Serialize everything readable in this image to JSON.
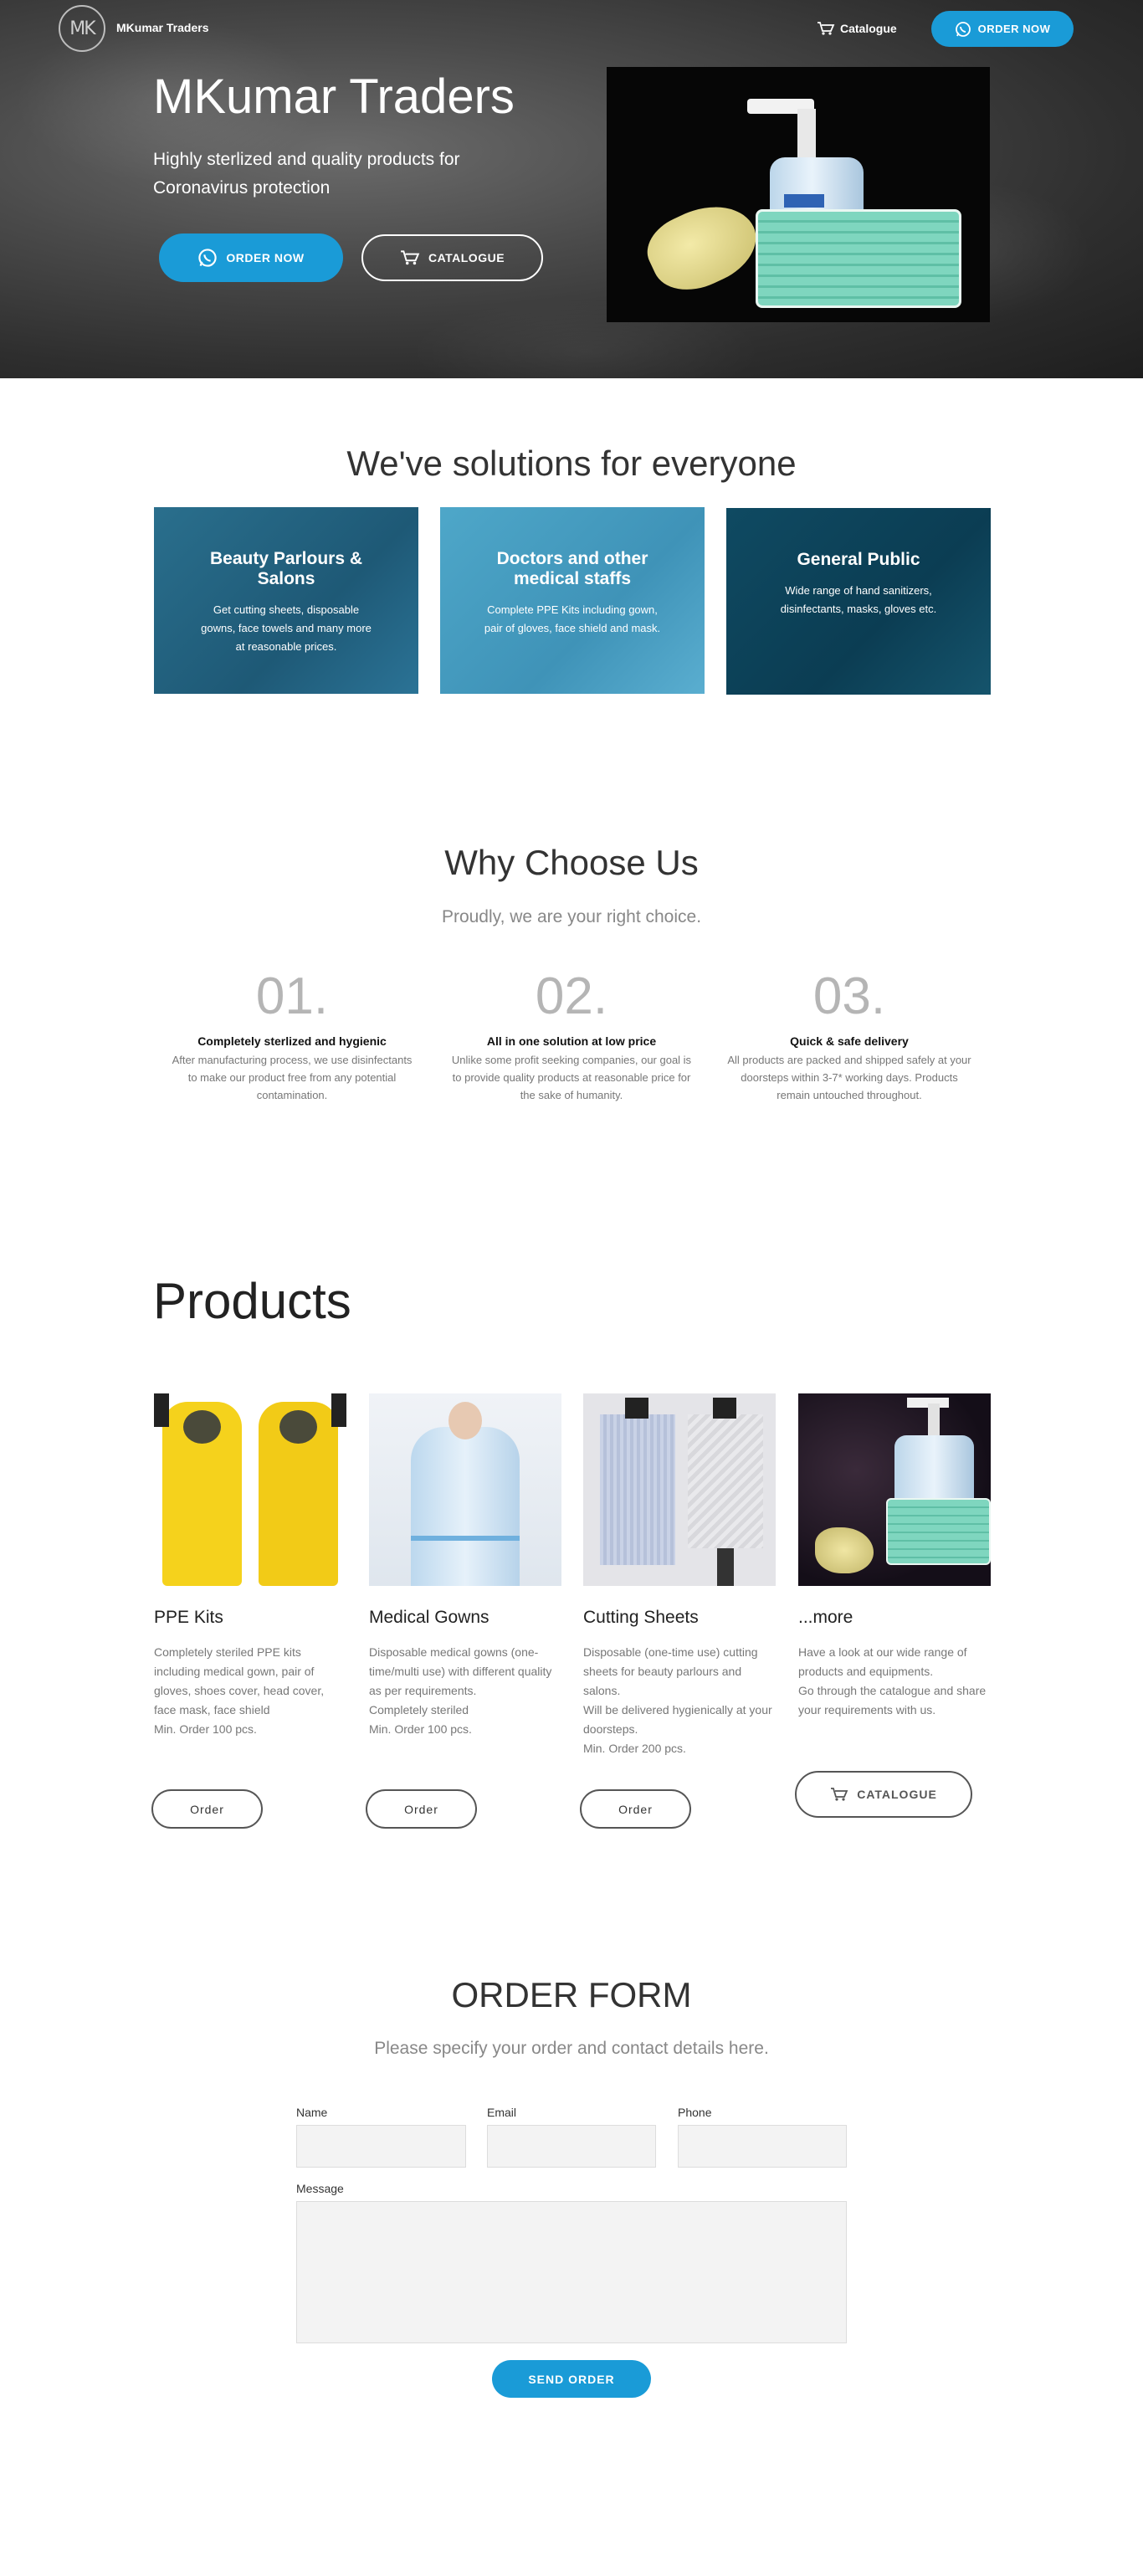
{
  "header": {
    "logo_text": "MK",
    "brand": "MKumar Traders",
    "catalogue_link": "Catalogue",
    "order_button": "ORDER NOW"
  },
  "hero": {
    "title": "MKumar Traders",
    "subtitle": "Highly sterlized and quality products for Coronavirus protection",
    "order_button": "ORDER NOW",
    "catalogue_button": "CATALOGUE"
  },
  "solutions": {
    "title": "We've solutions for everyone",
    "cards": [
      {
        "title": "Beauty Parlours & Salons",
        "text": "Get cutting sheets, disposable gowns, face towels and many more at reasonable prices."
      },
      {
        "title": "Doctors and other medical staffs",
        "text": "Complete PPE Kits including gown, pair of gloves, face shield and mask."
      },
      {
        "title": "General Public",
        "text": "Wide range of hand sanitizers, disinfectants, masks, gloves etc."
      }
    ]
  },
  "why": {
    "title": "Why Choose Us",
    "subtitle": "Proudly, we are your right choice.",
    "items": [
      {
        "num": "01.",
        "head": "Completely sterlized and hygienic",
        "text": "After manufacturing process, we use disinfectants to make our product free from any potential contamination."
      },
      {
        "num": "02.",
        "head": "All in one solution at low price",
        "text": "Unlike some profit seeking companies, our goal is to provide quality products at reasonable price for the sake of humanity."
      },
      {
        "num": "03.",
        "head": "Quick & safe delivery",
        "text": "All products are packed and shipped safely at your doorsteps within 3-7* working days. Products remain untouched throughout."
      }
    ]
  },
  "products": {
    "title": "Products",
    "items": [
      {
        "name": "PPE Kits",
        "desc": "Completely steriled PPE kits including medical gown, pair of gloves, shoes cover, head cover, face mask, face shield\nMin. Order 100 pcs.",
        "button": "Order"
      },
      {
        "name": "Medical Gowns",
        "desc": "Disposable medical gowns (one-time/multi use) with different quality as per requirements.\nCompletely steriled\nMin. Order 100 pcs.",
        "button": "Order"
      },
      {
        "name": "Cutting Sheets",
        "desc": "Disposable (one-time use) cutting sheets for beauty parlours and salons.\nWill be delivered hygienically at your doorsteps.\nMin. Order 200 pcs.",
        "button": "Order"
      },
      {
        "name": "...more",
        "desc": "Have a look at our wide range of products and equipments.\nGo through the catalogue and share your requirements with us.",
        "button": "CATALOGUE"
      }
    ]
  },
  "order_form": {
    "title": "ORDER FORM",
    "subtitle": "Please specify your order and contact details here.",
    "name_label": "Name",
    "email_label": "Email",
    "phone_label": "Phone",
    "message_label": "Message",
    "submit": "SEND ORDER"
  },
  "colors": {
    "accent": "#1a9bd7",
    "card_beauty": "#1e5976",
    "card_doctors": "#3f93b8",
    "card_public": "#0b3d53"
  }
}
